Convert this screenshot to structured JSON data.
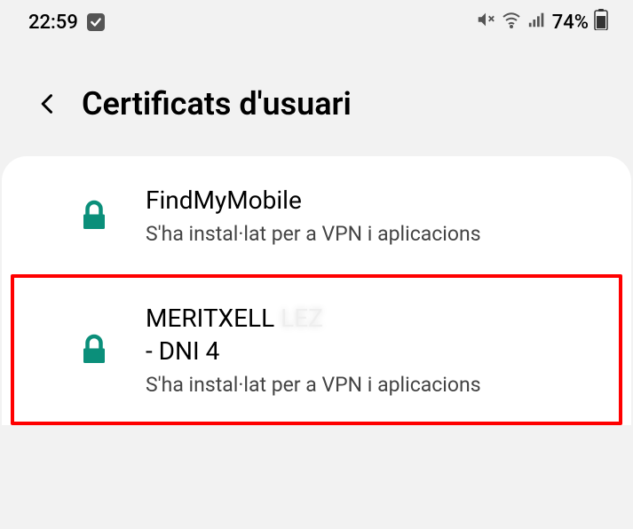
{
  "status_bar": {
    "time": "22:59",
    "battery_text": "74%"
  },
  "header": {
    "title": "Certificats d'usuari"
  },
  "certs": [
    {
      "title_line1": "FindMyMobile",
      "title_line2": "",
      "subtitle": "S'ha instal·lat per a VPN i aplicacions",
      "highlighted": false
    },
    {
      "title_line1": "MERITXELL",
      "title_line1_redacted": "LEZ",
      "title_line2": "- DNI 4",
      "subtitle": "S'ha instal·lat per a VPN i aplicacions",
      "highlighted": true
    }
  ]
}
